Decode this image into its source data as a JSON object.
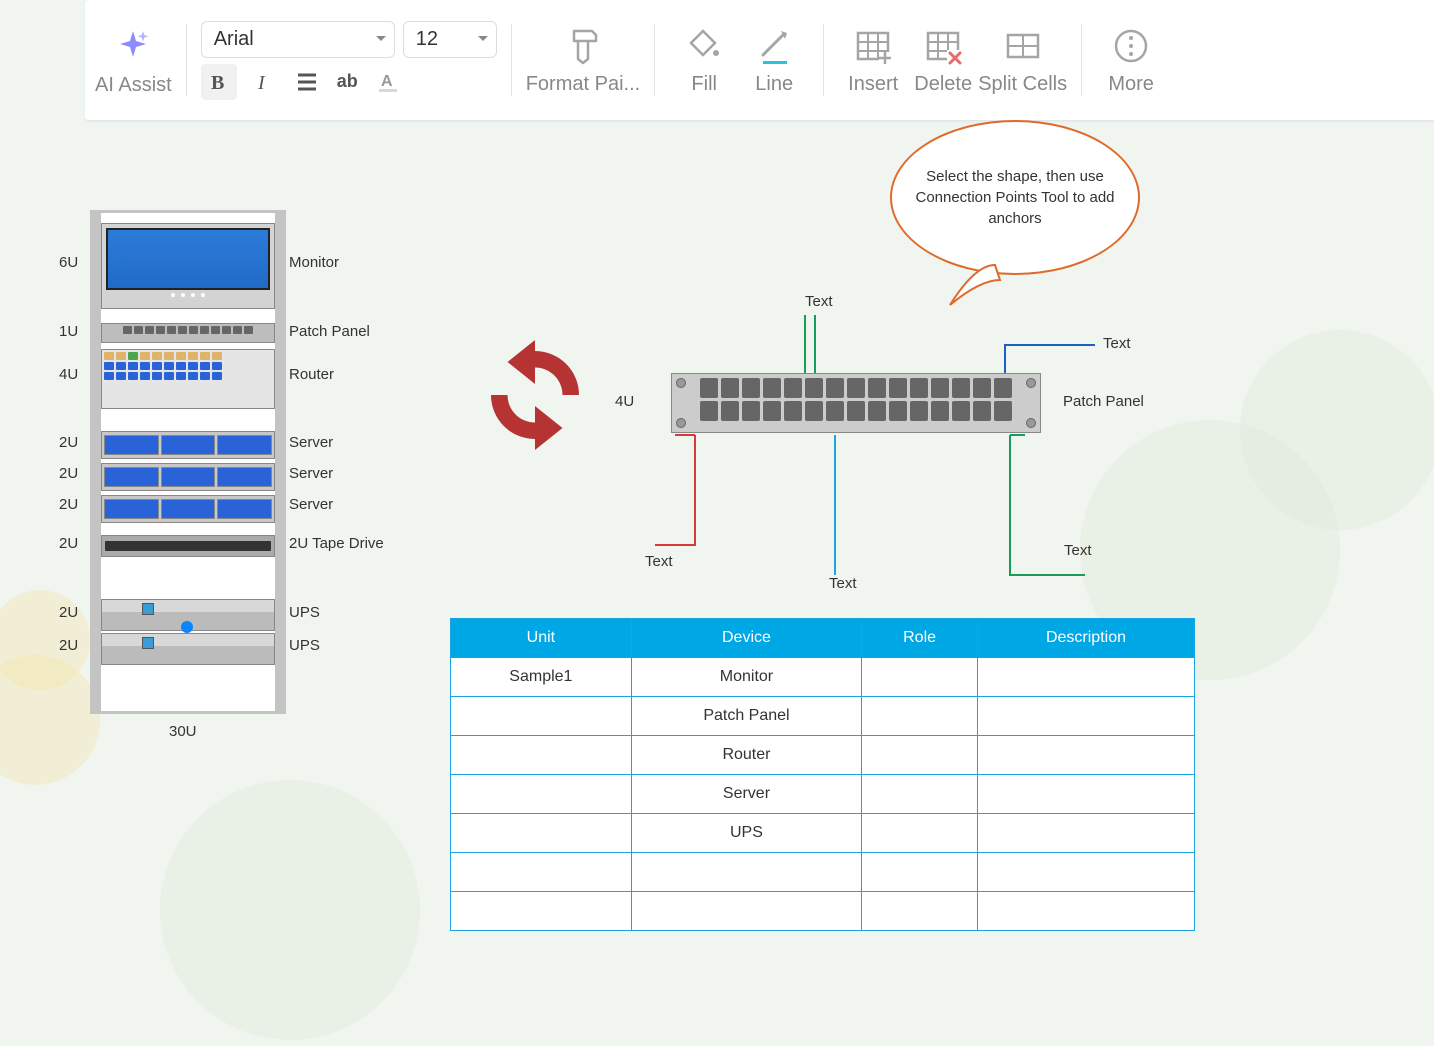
{
  "toolbar": {
    "ai_assist": "AI Assist",
    "font_name": "Arial",
    "font_size": "12",
    "format_painter": "Format Pai...",
    "fill": "Fill",
    "line": "Line",
    "insert": "Insert",
    "delete": "Delete",
    "split_cells": "Split Cells",
    "more": "More"
  },
  "rack": {
    "total": "30U",
    "items": [
      {
        "u": "6U",
        "label": "Monitor"
      },
      {
        "u": "1U",
        "label": "Patch Panel"
      },
      {
        "u": "4U",
        "label": "Router"
      },
      {
        "u": "2U",
        "label": "Server"
      },
      {
        "u": "2U",
        "label": "Server"
      },
      {
        "u": "2U",
        "label": "Server"
      },
      {
        "u": "2U",
        "label": "2U Tape Drive"
      },
      {
        "u": "2U",
        "label": "UPS"
      },
      {
        "u": "2U",
        "label": "UPS"
      }
    ]
  },
  "patch": {
    "u_label": "4U",
    "name": "Patch Panel",
    "ports": [
      {
        "label": "Text"
      },
      {
        "label": "Text"
      },
      {
        "label": "Text"
      },
      {
        "label": "Text"
      },
      {
        "label": "Text"
      }
    ]
  },
  "callout": "Select the shape, then use Connection Points Tool to add anchors",
  "table": {
    "headers": [
      "Unit",
      "Device",
      "Role",
      "Description"
    ],
    "rows": [
      [
        "Sample1",
        "Monitor",
        "",
        ""
      ],
      [
        "",
        "Patch Panel",
        "",
        ""
      ],
      [
        "",
        "Router",
        "",
        ""
      ],
      [
        "",
        "Server",
        "",
        ""
      ],
      [
        "",
        "UPS",
        "",
        ""
      ],
      [
        "",
        "",
        "",
        ""
      ],
      [
        "",
        "",
        "",
        ""
      ]
    ]
  }
}
